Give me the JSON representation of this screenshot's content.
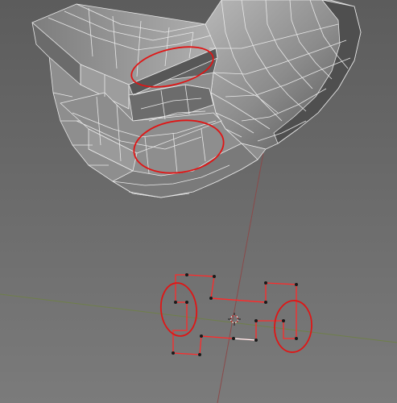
{
  "viewport": {
    "background_top": "#5d5d5d",
    "background_bottom": "#7a7a7a",
    "mesh_face_light": "#a9a9a9",
    "mesh_face_mid": "#8e8e8e",
    "mesh_face_dark": "#5a5a5a",
    "mesh_wire": "#e8e8e8",
    "axis_x_color": "#6f7f4a",
    "axis_z_color": "#8a4a4a",
    "annotation_color": "#e01515",
    "selected_edge_color": "#ff2a2a",
    "selected_vertex_color": "#1a1a1a",
    "active_edge_color": "#ffffff"
  },
  "scene": {
    "object_mode": "edit-mesh",
    "select_mode": "vertex",
    "annotations": 4,
    "profile_vertices_selected": 16
  }
}
